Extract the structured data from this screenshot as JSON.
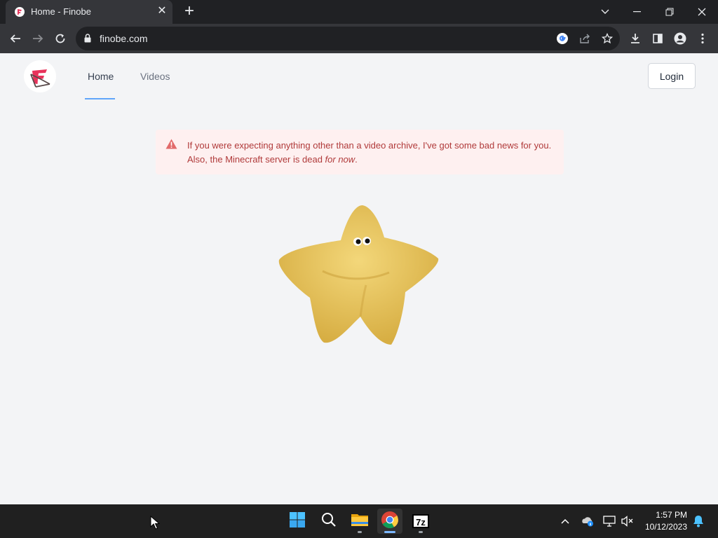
{
  "browser": {
    "tab_title": "Home - Finobe",
    "url": "finobe.com",
    "tab_close_glyph": "✕",
    "new_tab_glyph": "+",
    "icons": [
      "finobe-favicon",
      "back-icon",
      "forward-icon",
      "reload-icon",
      "lock-icon",
      "google-lens-icon",
      "share-icon",
      "bookmark-star-icon",
      "download-icon",
      "side-panel-icon",
      "profile-icon",
      "menu-icon",
      "tab-search-icon",
      "minimize-icon",
      "restore-icon",
      "close-icon"
    ]
  },
  "site": {
    "nav": [
      {
        "label": "Home",
        "active": true
      },
      {
        "label": "Videos",
        "active": false
      }
    ],
    "login_label": "Login",
    "alert": {
      "line1": "If you were expecting anything other than a video archive, I've got some bad news for you.",
      "line2_prefix": "Also, the Minecraft server is dead ",
      "line2_emph": "for now",
      "line2_suffix": "."
    },
    "colors": {
      "accent": "#60a5fa",
      "alert_bg": "#fef0f0",
      "alert_text": "#b03a3a",
      "logo": "#e8335b",
      "star": "#e8c45a"
    }
  },
  "taskbar": {
    "apps": [
      {
        "name": "start",
        "icon": "windows-icon"
      },
      {
        "name": "search",
        "icon": "search-icon"
      },
      {
        "name": "file-explorer",
        "icon": "folder-icon"
      },
      {
        "name": "chrome",
        "icon": "chrome-icon",
        "active": true
      },
      {
        "name": "7-zip",
        "icon": "7zip-icon",
        "label": "7z"
      }
    ],
    "time": "1:57 PM",
    "date": "10/12/2023",
    "tray_icons": [
      "chevron-up-icon",
      "onedrive-icon",
      "network-icon",
      "volume-muted-icon",
      "notification-bell-icon"
    ]
  }
}
